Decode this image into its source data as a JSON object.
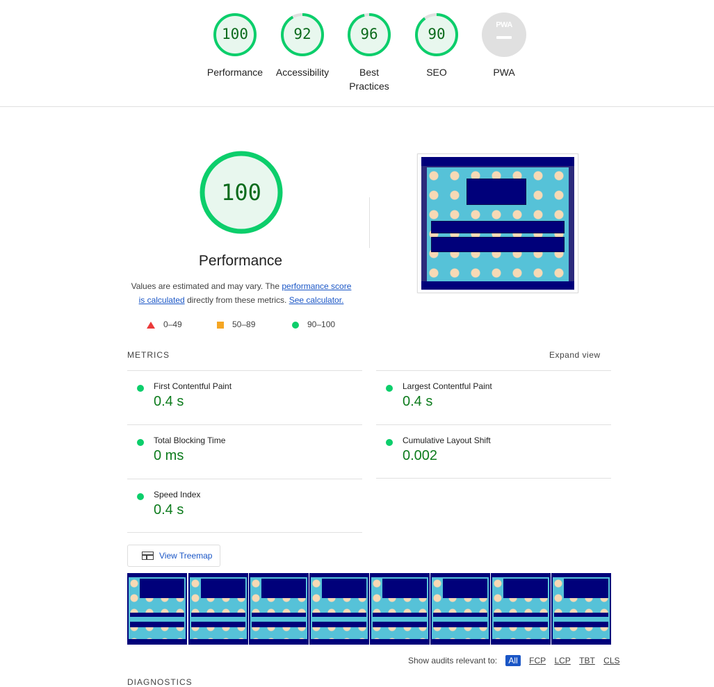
{
  "categories": [
    {
      "label": "Performance",
      "score": "100"
    },
    {
      "label": "Accessibility",
      "score": "92"
    },
    {
      "label": "Best Practices",
      "score": "96"
    },
    {
      "label": "SEO",
      "score": "90"
    },
    {
      "label": "PWA",
      "badge": "PWA"
    }
  ],
  "performance": {
    "score": "100",
    "title": "Performance",
    "desc_prefix": "Values are estimated and may vary. The ",
    "link_score": "performance score is calculated",
    "desc_middle": " directly from these metrics. ",
    "link_calc": "See calculator."
  },
  "legend": {
    "fail": "0–49",
    "average": "50–89",
    "pass": "90–100"
  },
  "metrics": {
    "heading": "METRICS",
    "expand": "Expand view",
    "items": [
      {
        "title": "First Contentful Paint",
        "value": "0.4 s"
      },
      {
        "title": "Largest Contentful Paint",
        "value": "0.4 s"
      },
      {
        "title": "Total Blocking Time",
        "value": "0 ms"
      },
      {
        "title": "Cumulative Layout Shift",
        "value": "0.002"
      },
      {
        "title": "Speed Index",
        "value": "0.4 s"
      }
    ]
  },
  "treemap": {
    "label": "View Treemap"
  },
  "filter": {
    "label": "Show audits relevant to:",
    "chips": [
      "All",
      "FCP",
      "LCP",
      "TBT",
      "CLS"
    ]
  },
  "diagnostics": {
    "heading": "DIAGNOSTICS"
  },
  "colors": {
    "pass": "#0cce6b",
    "pass_text": "#0c6b1c",
    "link": "#1a56c6"
  }
}
